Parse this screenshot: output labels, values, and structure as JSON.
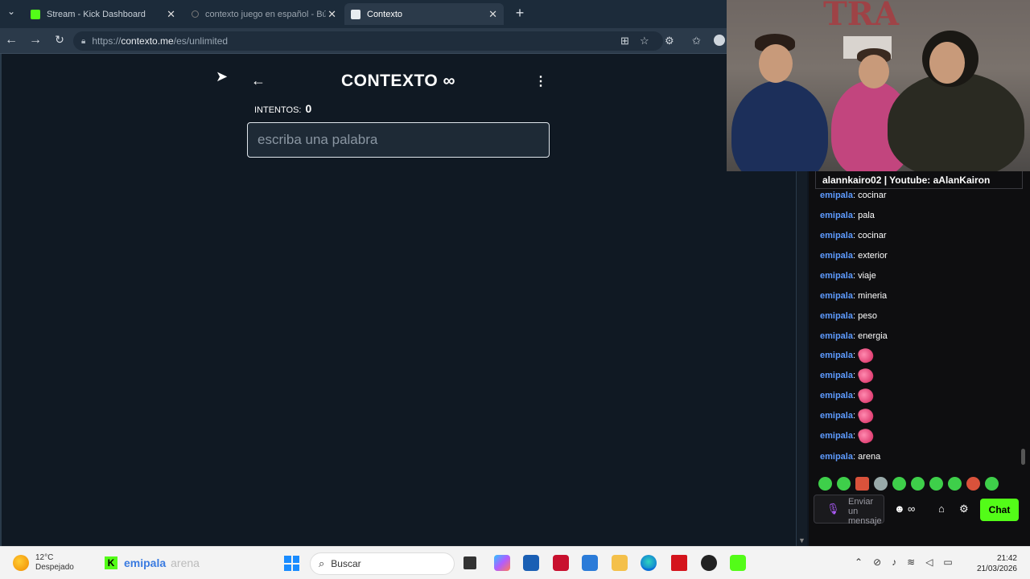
{
  "browser": {
    "tabs": [
      {
        "label": "Stream - Kick Dashboard",
        "active": false
      },
      {
        "label": "contexto juego en español - Búsq",
        "active": false
      },
      {
        "label": "Contexto",
        "active": true
      }
    ],
    "new_tab": "+",
    "url_prefix": "https://",
    "url_host": "contexto.me",
    "url_path": "/es/unlimited"
  },
  "game": {
    "title": "CONTEXTO",
    "title_symbol": "∞",
    "attempts_label": "INTENTOS:",
    "attempts_value": "0",
    "input_placeholder": "escriba una palabra"
  },
  "webcam": {
    "wall_text": "TRA"
  },
  "chat": {
    "header": "alannkairo02 | Youtube: aAlanKairon",
    "messages": [
      {
        "user": "emipala",
        "text": "cocinar"
      },
      {
        "user": "emipala",
        "text": "pala"
      },
      {
        "user": "emipala",
        "text": "cocinar"
      },
      {
        "user": "emipala",
        "text": "exterior"
      },
      {
        "user": "emipala",
        "text": "viaje"
      },
      {
        "user": "emipala",
        "text": "mineria"
      },
      {
        "user": "emipala",
        "text": "peso"
      },
      {
        "user": "emipala",
        "text": "energia"
      },
      {
        "user": "emipala",
        "text": ""
      },
      {
        "user": "emipala",
        "text": ""
      },
      {
        "user": "emipala",
        "text": ""
      },
      {
        "user": "emipala",
        "text": ""
      },
      {
        "user": "emipala",
        "text": ""
      },
      {
        "user": "emipala",
        "text": "arena"
      }
    ],
    "input_placeholder": "Enviar un mensaje",
    "send_label": "Chat",
    "infinity": "∞"
  },
  "taskbar": {
    "temperature": "12°C",
    "weather": "Despejado",
    "kick_user": "emipala",
    "kick_word": "arena",
    "search_placeholder": "Buscar",
    "time": "21:42",
    "date": "21/03/2026"
  },
  "colors": {
    "page_bg": "#101923",
    "kick_green": "#53fc18",
    "chat_user": "#5e9bff"
  }
}
